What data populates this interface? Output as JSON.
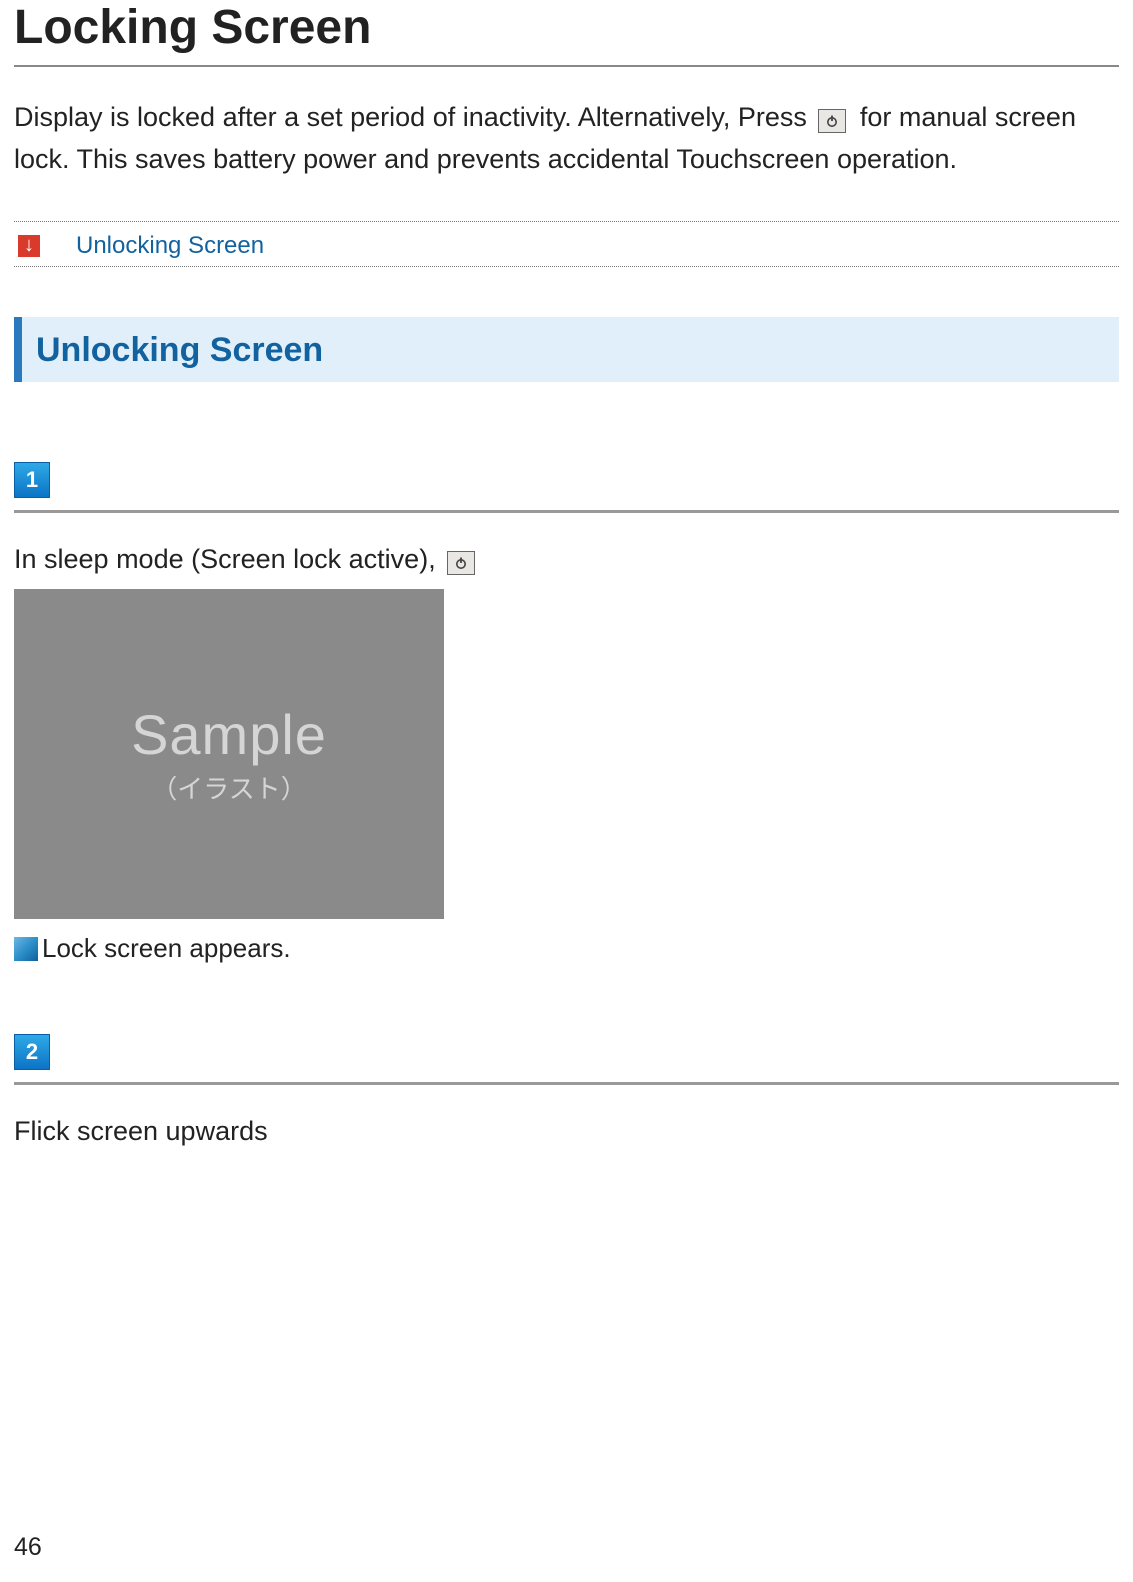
{
  "pageTitle": "Locking Screen",
  "intro": {
    "part1": "Display is locked after a set period of inactivity. Alternatively, Press ",
    "part2": " for manual screen lock. This saves battery power and prevents accidental Touchscreen operation."
  },
  "linkListItem": "Unlocking Screen",
  "sectionHeading": "Unlocking Screen",
  "steps": {
    "step1": {
      "number": "1",
      "text": "In sleep mode (Screen lock active), ",
      "sampleMain": "Sample",
      "sampleSub": "（イラスト）",
      "note": "Lock screen appears."
    },
    "step2": {
      "number": "2",
      "text": "Flick screen upwards"
    }
  },
  "pageNumber": "46"
}
